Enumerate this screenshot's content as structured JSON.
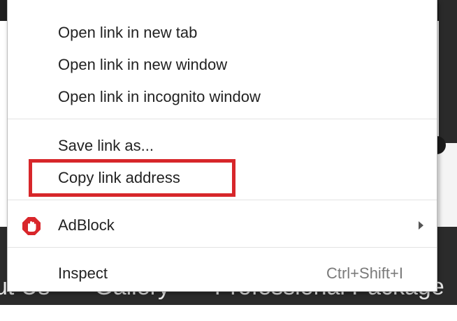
{
  "background": {
    "nav_items": [
      "ut Us",
      "Gallery",
      "Professional Package"
    ],
    "nav_separator": "•"
  },
  "context_menu": {
    "groups": [
      [
        {
          "label": "Open link in new tab"
        },
        {
          "label": "Open link in new window"
        },
        {
          "label": "Open link in incognito window"
        }
      ],
      [
        {
          "label": "Save link as..."
        },
        {
          "label": "Copy link address",
          "highlighted": true
        }
      ],
      [
        {
          "label": "AdBlock",
          "icon": "adblock-icon",
          "submenu": true
        }
      ],
      [
        {
          "label": "Inspect",
          "shortcut": "Ctrl+Shift+I"
        }
      ]
    ],
    "highlight_color": "#d7262a"
  }
}
